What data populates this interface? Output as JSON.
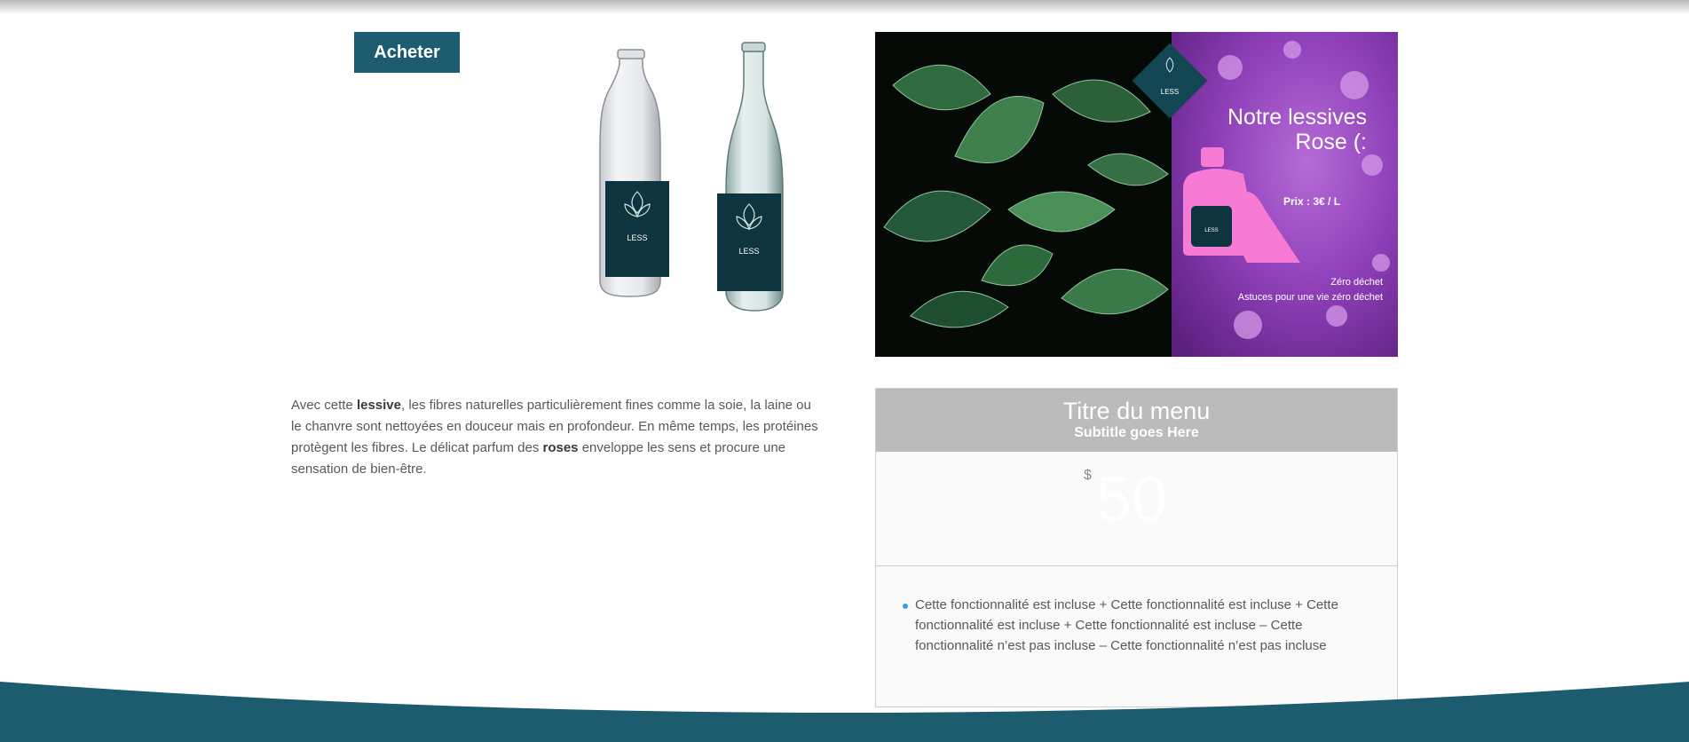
{
  "buy_button": {
    "label": "Acheter"
  },
  "bottle_label": "LESS",
  "hero": {
    "brand": "LESS",
    "headline_line1": "Notre  lessives",
    "headline_line2": "Rose (:",
    "price": "Prix :  3€ / L",
    "tagline1": "Zéro déchet",
    "tagline2": "Astuces pour une vie zéro déchet",
    "product_label": "LESS"
  },
  "description": {
    "part1": "Avec cette ",
    "bold1": "lessive",
    "part2": ", les fibres naturelles particulièrement fines comme la soie, la laine ou le chanvre sont nettoyées en douceur mais en profondeur. En même temps, les protéines protègent les fibres. Le délicat parfum des ",
    "bold2": "roses",
    "part3": " enveloppe les sens et procure une sensation de bien-être."
  },
  "pricing": {
    "title": "Titre du menu",
    "subtitle": "Subtitle goes Here",
    "currency": "$",
    "amount": "50",
    "feature": "Cette fonctionnalité est incluse + Cette fonctionnalité est incluse + Cette fonctionnalité est incluse + Cette fonctionnalité est incluse – Cette fonctionnalité n’est pas incluse – Cette fonctionnalité n’est pas incluse"
  },
  "colors": {
    "accent": "#1d5b6e",
    "label_dark": "#0e3440",
    "pink": "#f77bd4",
    "bullet": "#3aa0e6"
  }
}
